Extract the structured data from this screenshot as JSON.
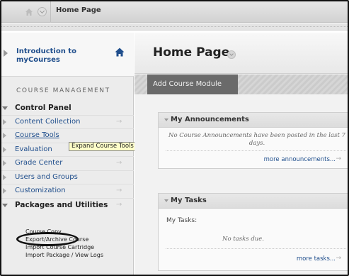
{
  "breadcrumb": {
    "current": "Home Page"
  },
  "sidebar": {
    "course_title": "Introduction to myCourses",
    "section_header": "COURSE MANAGEMENT",
    "items": [
      {
        "label": "Control Panel"
      },
      {
        "label": "Content Collection",
        "arrow": "→"
      },
      {
        "label": "Course Tools"
      },
      {
        "label": "Evaluation"
      },
      {
        "label": "Grade Center",
        "arrow": "→"
      },
      {
        "label": "Users and Groups"
      },
      {
        "label": "Customization",
        "arrow": "→"
      },
      {
        "label": "Packages and Utilities",
        "arrow": "→"
      }
    ],
    "tooltip": "Expand Course Tools",
    "package_links": [
      "Course Copy",
      "Export/Archive Course",
      "Import Course Cartridge",
      "Import Package / View Logs"
    ]
  },
  "main": {
    "page_title": "Home Page",
    "add_module_label": "Add Course Module",
    "announcements": {
      "title": "My Announcements",
      "empty_message": "No Course Announcements have been posted in the last 7 days.",
      "more_label": "more announcements...",
      "arrow": "→"
    },
    "tasks": {
      "title": "My Tasks",
      "label": "My Tasks:",
      "empty_message": "No tasks due.",
      "more_label": "more tasks...",
      "arrow": "→"
    }
  }
}
